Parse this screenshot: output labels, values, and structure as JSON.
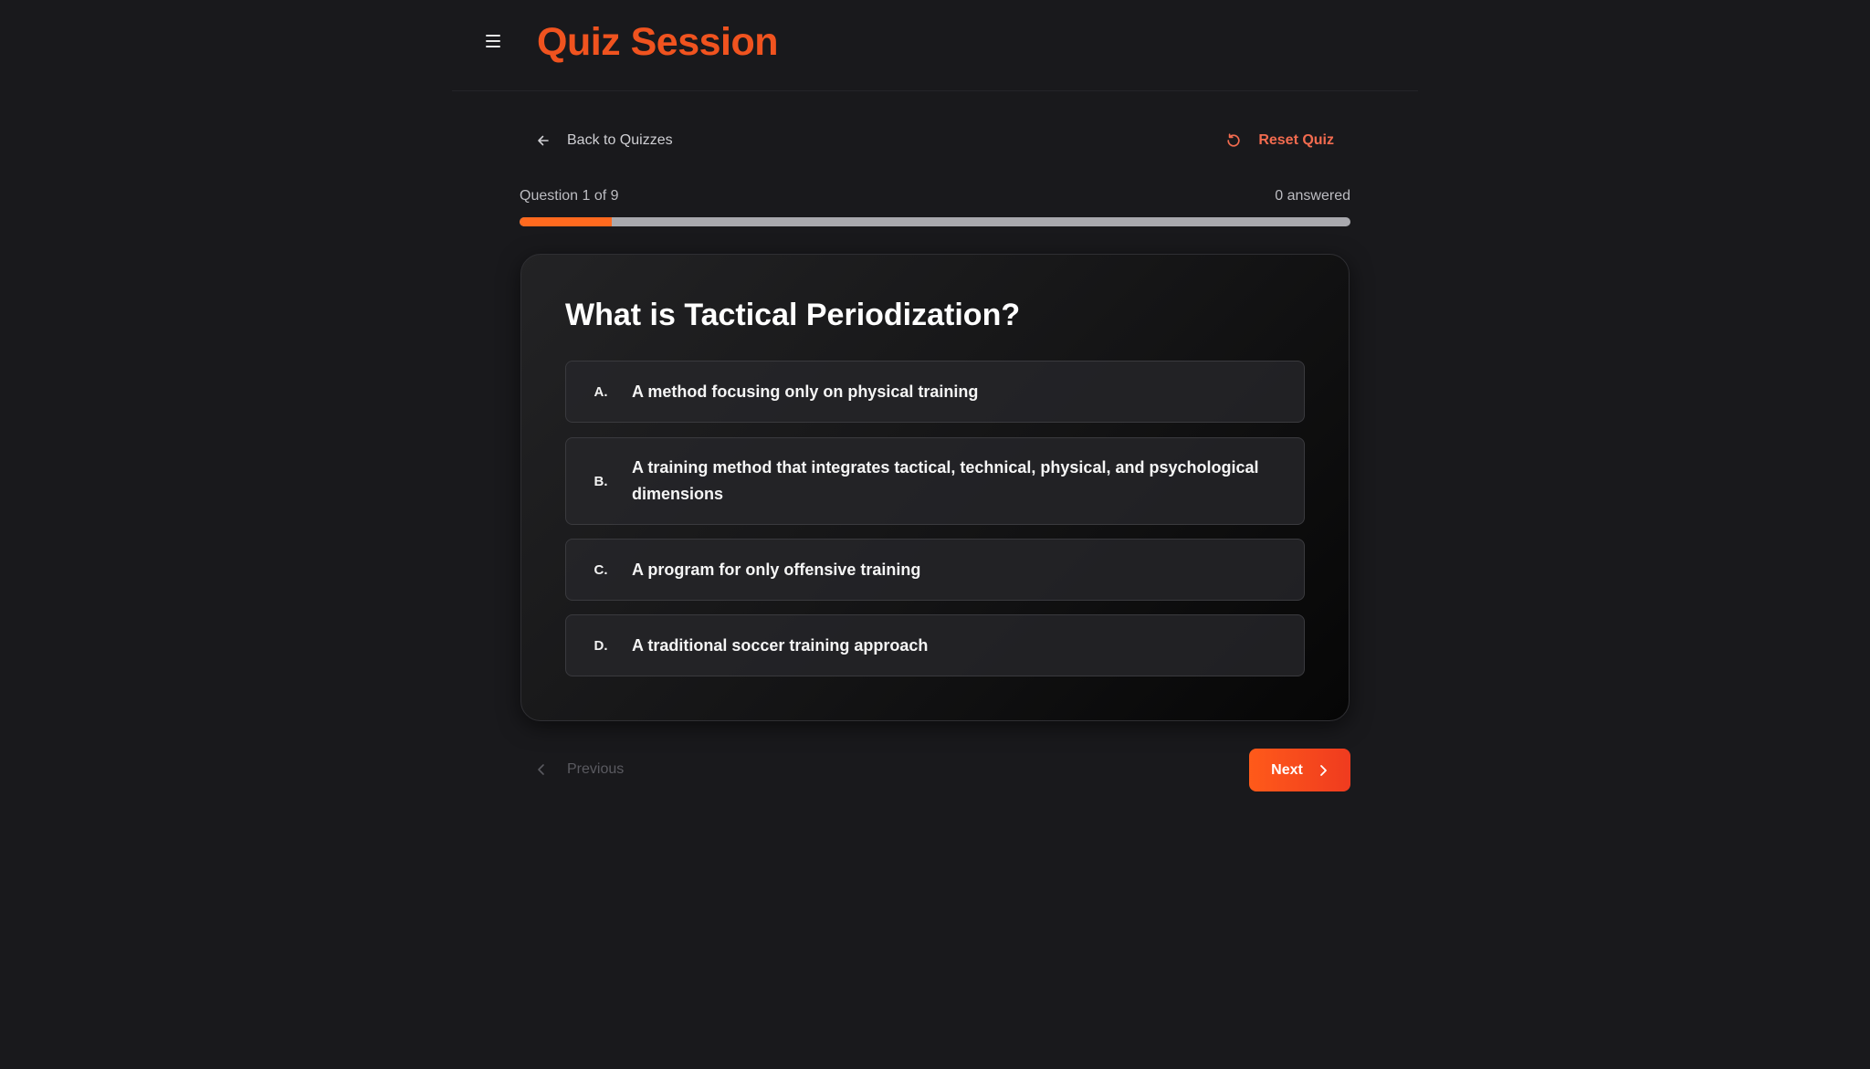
{
  "header": {
    "title": "Quiz Session",
    "menu_icon": "hamburger-menu-icon"
  },
  "nav": {
    "back_label": "Back to Quizzes",
    "back_icon": "arrow-left-icon",
    "reset_label": "Reset Quiz",
    "reset_icon": "rotate-ccw-icon"
  },
  "progress": {
    "question_label": "Question 1 of 9",
    "answered_label": "0 answered",
    "current": 1,
    "total": 9,
    "fraction": 0.1111
  },
  "question": {
    "text": "What is Tactical Periodization?",
    "options": [
      {
        "letter": "A.",
        "text": "A method focusing only on physical training"
      },
      {
        "letter": "B.",
        "text": "A training method that integrates tactical, technical, physical, and psychological dimensions"
      },
      {
        "letter": "C.",
        "text": "A program for only offensive training"
      },
      {
        "letter": "D.",
        "text": "A traditional soccer training approach"
      }
    ]
  },
  "footer": {
    "previous_label": "Previous",
    "previous_icon": "chevron-left-icon",
    "next_label": "Next",
    "next_icon": "chevron-right-icon"
  },
  "colors": {
    "background": "#19191c",
    "accent": "#f0531f",
    "progress_fill": "#ff6a1f",
    "progress_track": "#a9a9ae",
    "reset": "#f26b4f"
  }
}
